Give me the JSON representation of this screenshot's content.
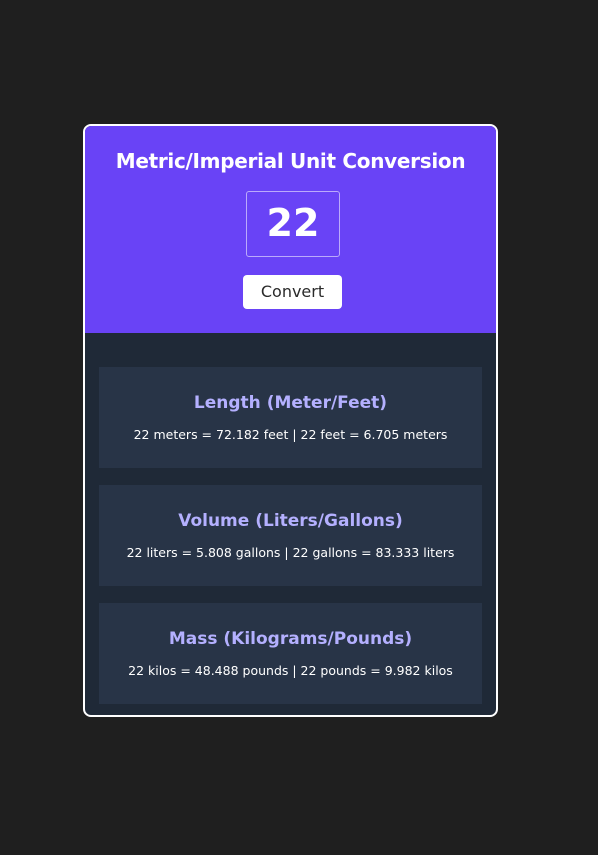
{
  "header": {
    "title": "Metric/Imperial Unit Conversion",
    "input_value": "22",
    "convert_label": "Convert"
  },
  "results": [
    {
      "title": "Length (Meter/Feet)",
      "text": "22 meters = 72.182 feet | 22 feet = 6.705 meters"
    },
    {
      "title": "Volume (Liters/Gallons)",
      "text": "22 liters = 5.808 gallons | 22 gallons = 83.333 liters"
    },
    {
      "title": "Mass (Kilograms/Pounds)",
      "text": "22 kilos = 48.488 pounds | 22 pounds = 9.982 kilos"
    }
  ],
  "colors": {
    "page_background": "#1f1f1f",
    "header_background": "#6943f6",
    "results_background": "#1f2937",
    "result_card_background": "#283447",
    "result_title": "#b4b0ff"
  }
}
